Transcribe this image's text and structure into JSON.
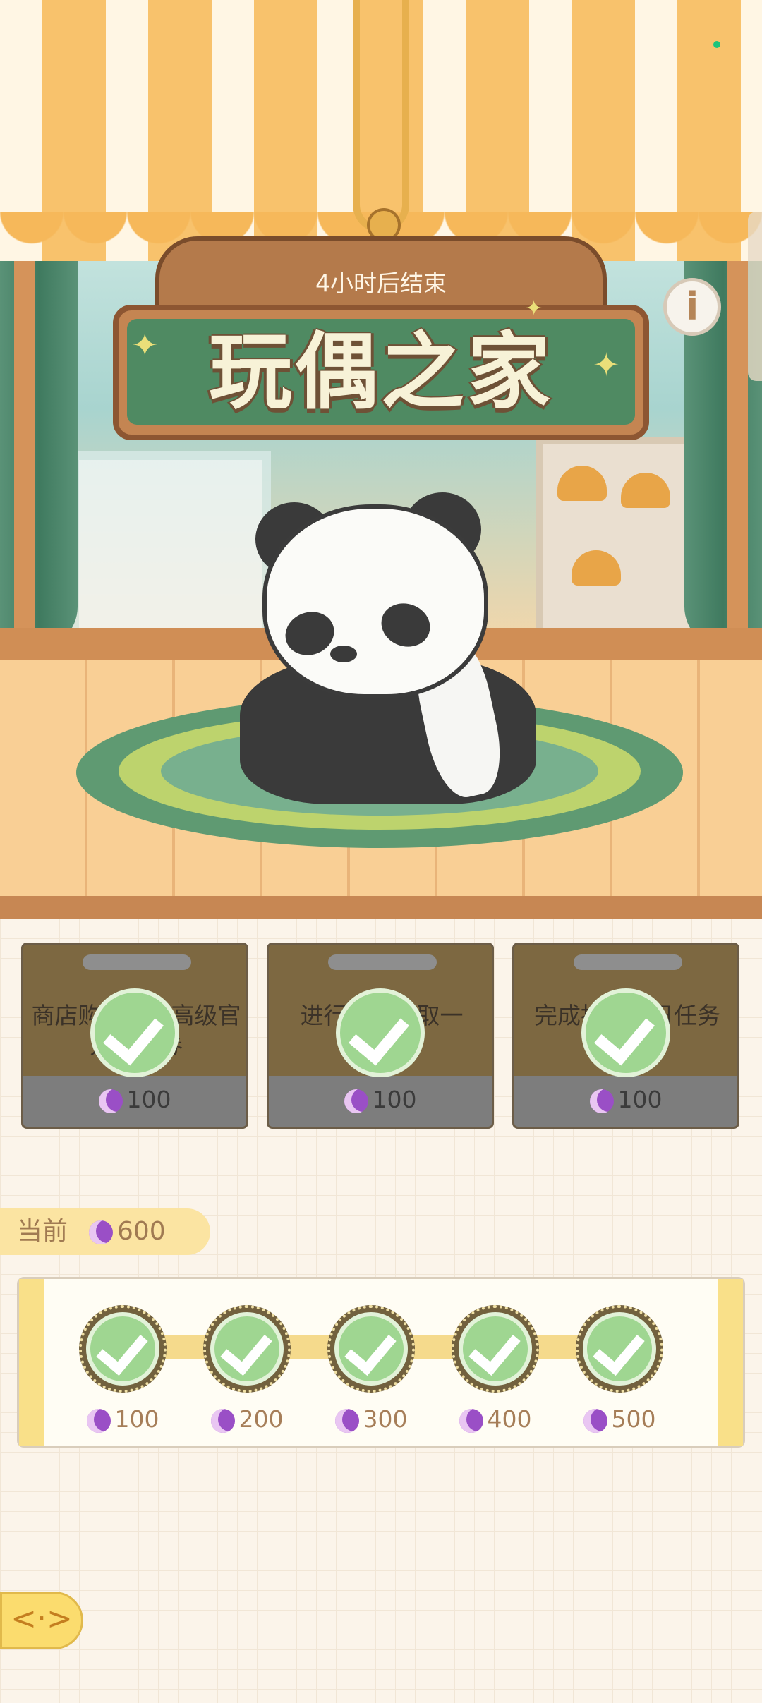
{
  "event": {
    "timer_text": "4小时后结束",
    "title": "玩偶之家"
  },
  "icons": {
    "info": "i",
    "back": "<·>"
  },
  "tasks": [
    {
      "text": "商店购买一次高级官方优惠券",
      "reward": "100",
      "completed": true
    },
    {
      "text": "进行抽奖领取一",
      "reward": "100",
      "completed": true
    },
    {
      "text": "完成抽奖首日任务",
      "reward": "100",
      "completed": true
    }
  ],
  "current": {
    "label": "当前",
    "value": "600"
  },
  "milestones": [
    {
      "reward": "100",
      "completed": true
    },
    {
      "reward": "200",
      "completed": true
    },
    {
      "reward": "300",
      "completed": true
    },
    {
      "reward": "400",
      "completed": true
    },
    {
      "reward": "500",
      "completed": true
    }
  ],
  "colors": {
    "accent_yellow": "#fbdc6e",
    "check_green": "#9fd691",
    "moon_purple": "#9a4fc6",
    "board_green": "#4f8a62"
  }
}
